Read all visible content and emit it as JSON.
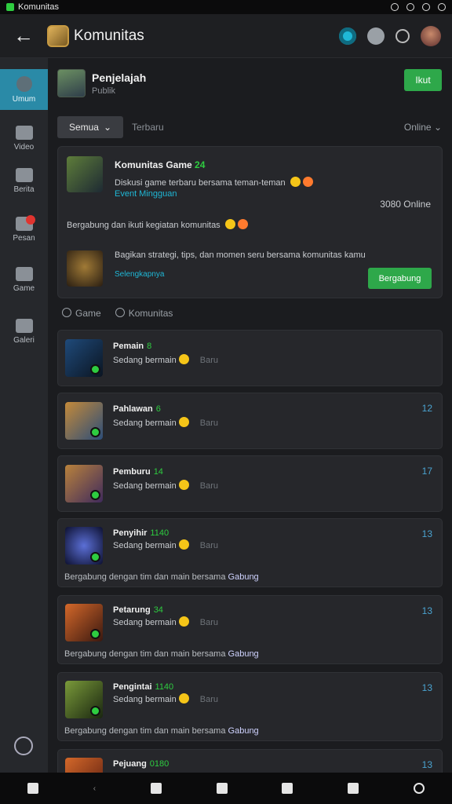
{
  "status": {
    "app_name": "Komunitas"
  },
  "header": {
    "title": "Komunitas",
    "back_icon": "back-arrow-icon"
  },
  "sidebar": {
    "items": [
      {
        "label": "Umum",
        "icon": "chat-icon"
      },
      {
        "label": "Video",
        "icon": "video-icon"
      },
      {
        "label": "Berita",
        "icon": "megaphone-icon"
      },
      {
        "label": "Pesan",
        "icon": "message-icon"
      },
      {
        "label": "Game",
        "icon": "game-icon"
      },
      {
        "label": "Galeri",
        "icon": "camera-icon"
      }
    ]
  },
  "page": {
    "name": "Penjelajah",
    "sub": "Publik",
    "join_label": "Ikut"
  },
  "filters": {
    "select_label": "Semua",
    "tab_label": "Terbaru",
    "sort_label": "Online"
  },
  "featured": {
    "title": "Komunitas Game",
    "title_badge": "24",
    "line1": "Diskusi game terbaru bersama teman-teman",
    "line2": "Event Mingguan",
    "online": "3080 Online",
    "line3": "Bergabung dan ikuti kegiatan komunitas",
    "line4": "Bagikan strategi, tips, dan momen seru bersama komunitas kamu",
    "line5": "Selengkapnya",
    "button_label": "Bergabung"
  },
  "tags": [
    "Game",
    "Komunitas"
  ],
  "cards": [
    {
      "name": "Pemain",
      "badge": "8",
      "meta": "Sedang bermain",
      "dim": "Baru",
      "count": "",
      "desc": ""
    },
    {
      "name": "Pahlawan",
      "badge": "6",
      "meta": "Sedang bermain",
      "dim": "Baru",
      "count": "12",
      "desc": ""
    },
    {
      "name": "Pemburu",
      "badge": "14",
      "meta": "Sedang bermain",
      "dim": "Baru",
      "count": "17",
      "desc": ""
    },
    {
      "name": "Penyihir",
      "badge": "1140",
      "meta": "Sedang bermain",
      "dim": "Baru",
      "count": "13",
      "desc": "Bergabung dengan tim dan main bersama",
      "desc_bold": "Gabung"
    },
    {
      "name": "Petarung",
      "badge": "34",
      "meta": "Sedang bermain",
      "dim": "Baru",
      "count": "13",
      "desc": "Bergabung dengan tim dan main bersama",
      "desc_bold": "Gabung"
    },
    {
      "name": "Pengintai",
      "badge": "1140",
      "meta": "Sedang bermain",
      "dim": "Baru",
      "count": "13",
      "desc": "Bergabung dengan tim dan main bersama",
      "desc_bold": "Gabung"
    },
    {
      "name": "Pejuang",
      "badge": "0180",
      "meta": "",
      "dim": "",
      "count": "13",
      "desc": ""
    }
  ],
  "colors": {
    "accent_green": "#2ea84a",
    "accent_blue": "#1fb7d6",
    "active_tab": "#2a8aa7"
  }
}
